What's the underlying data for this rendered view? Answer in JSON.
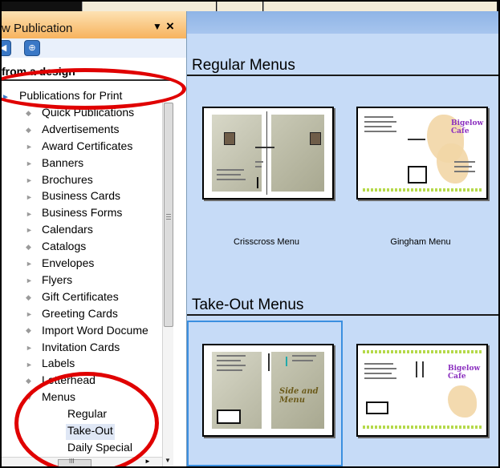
{
  "pane": {
    "title": "w Publication",
    "menu_glyph": "▼",
    "close_glyph": "×",
    "nav_back": "◀",
    "nav_forward": "⊕",
    "section_heading": "from a design",
    "root": {
      "label": "Publications for Print",
      "arrow": "►"
    },
    "items": [
      {
        "label": "Quick Publications",
        "bullet": "◆"
      },
      {
        "label": "Advertisements",
        "bullet": "◆"
      },
      {
        "label": "Award Certificates",
        "bullet": "►"
      },
      {
        "label": "Banners",
        "bullet": "►"
      },
      {
        "label": "Brochures",
        "bullet": "►"
      },
      {
        "label": "Business Cards",
        "bullet": "►"
      },
      {
        "label": "Business Forms",
        "bullet": "►"
      },
      {
        "label": "Calendars",
        "bullet": "►"
      },
      {
        "label": "Catalogs",
        "bullet": "◆"
      },
      {
        "label": "Envelopes",
        "bullet": "►"
      },
      {
        "label": "Flyers",
        "bullet": "►"
      },
      {
        "label": "Gift Certificates",
        "bullet": "◆"
      },
      {
        "label": "Greeting Cards",
        "bullet": "►"
      },
      {
        "label": "Import Word Docume",
        "bullet": "◆"
      },
      {
        "label": "Invitation Cards",
        "bullet": "►"
      },
      {
        "label": "Labels",
        "bullet": "►"
      },
      {
        "label": "Letterhead",
        "bullet": "◆"
      },
      {
        "label": "Menus",
        "bullet": "▼"
      }
    ],
    "subitems": [
      {
        "label": "Regular",
        "selected": false
      },
      {
        "label": "Take-Out",
        "selected": true
      },
      {
        "label": "Daily Special",
        "selected": false
      }
    ],
    "scroll_down": "▼",
    "scroll_right": "►",
    "hscroll_grip": "III"
  },
  "gallery": {
    "sections": [
      {
        "heading": "Regular Menus",
        "templates": [
          {
            "caption": "Crisscross Menu",
            "selected": false
          },
          {
            "caption": "Gingham Menu",
            "selected": false
          }
        ]
      },
      {
        "heading": "Take-Out Menus",
        "templates": [
          {
            "caption": "",
            "selected": true
          },
          {
            "caption": "",
            "selected": false
          }
        ]
      }
    ]
  },
  "thumb_text": {
    "gingham_title": "Bigelow Cafe",
    "crisscross_script": "Side and Menu",
    "takeout_title": "Bigelow Cafe"
  },
  "colors": {
    "annotation": "#e00000",
    "pane_header": "#f7b35d",
    "gallery_bg": "#c6dbf7",
    "selection": "#3b8fe0"
  }
}
